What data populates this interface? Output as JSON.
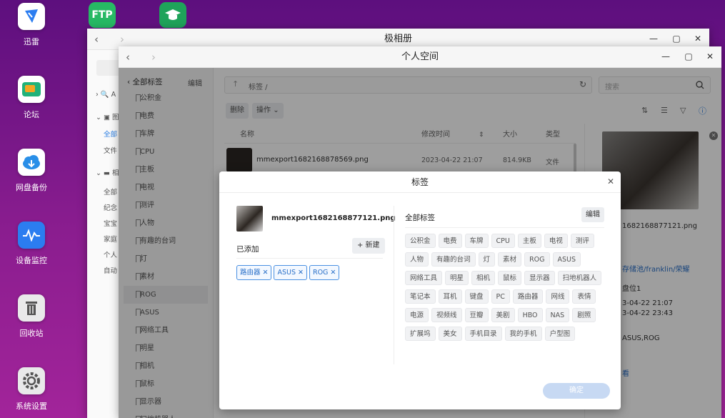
{
  "desktop": {
    "icons": [
      {
        "label": "迅雷",
        "icon": "xunlei-icon"
      },
      {
        "label": "论坛",
        "icon": "forum-icon"
      },
      {
        "label": "网盘备份",
        "icon": "cloud-backup-icon"
      },
      {
        "label": "设备监控",
        "icon": "monitor-icon"
      },
      {
        "label": "回收站",
        "icon": "trash-icon"
      },
      {
        "label": "系统设置",
        "icon": "settings-icon"
      }
    ],
    "top_icons": [
      {
        "label": "FTP"
      },
      {
        "label": "",
        "icon": "graduation-cap-icon"
      }
    ]
  },
  "back_window": {
    "title": "极相册",
    "sidebar": [
      {
        "text": "A"
      },
      {
        "text": "图"
      },
      {
        "text": "全部"
      },
      {
        "text": "文件"
      },
      {
        "text": "相"
      },
      {
        "text": "全部"
      },
      {
        "text": "纪念"
      },
      {
        "text": "宝宝"
      },
      {
        "text": "家庭"
      },
      {
        "text": "个人"
      },
      {
        "text": "自动"
      }
    ]
  },
  "front_window": {
    "title": "个人空间",
    "left_header": "全部标签",
    "left_edit": "编辑",
    "tags_list": [
      "公积金",
      "电费",
      "车牌",
      "CPU",
      "主板",
      "电视",
      "测评",
      "人物",
      "有趣的台词",
      "灯",
      "素材",
      "ROG",
      "ASUS",
      "网络工具",
      "明星",
      "相机",
      "鼠标",
      "显示器",
      "扫地机器人"
    ],
    "selected_tag": "ROG",
    "path": "标签 /",
    "search_placeholder": "搜索",
    "buttons": {
      "delete": "删除",
      "operate": "操作"
    },
    "columns": {
      "name": "名称",
      "modified": "修改时间",
      "size": "大小",
      "type": "类型"
    },
    "row": {
      "name": "mmexport1682168878569.png",
      "modified": "2023-04-22 21:07",
      "size": "814.9KB",
      "type": "文件"
    },
    "info_panel": {
      "filename": "1682168877121.png",
      "path": "存储池/franklin/荣耀",
      "location": "盘位1",
      "date1": "3-04-22 21:07",
      "date2": "3-04-22 23:43",
      "tags": "ASUS,ROG",
      "link": "看"
    }
  },
  "dialog": {
    "title": "标签",
    "filename": "mmexport1682168877121.png",
    "added_label": "已添加",
    "new_button": "+ 新建",
    "added_tags": [
      "路由器",
      "ASUS",
      "ROG"
    ],
    "all_tags_label": "全部标签",
    "edit_button": "编辑",
    "all_tags": [
      "公积金",
      "电费",
      "车牌",
      "CPU",
      "主板",
      "电视",
      "测评",
      "人物",
      "有趣的台词",
      "灯",
      "素材",
      "ROG",
      "ASUS",
      "网络工具",
      "明星",
      "相机",
      "鼠标",
      "显示器",
      "扫地机器人",
      "笔记本",
      "耳机",
      "键盘",
      "PC",
      "路由器",
      "网线",
      "表情",
      "电源",
      "视频线",
      "豆瓣",
      "美剧",
      "HBO",
      "NAS",
      "剧照",
      "扩展坞",
      "美女",
      "手机目录",
      "我的手机",
      "户型图"
    ],
    "confirm": "确定"
  },
  "colors": {
    "accent": "#4a90e2",
    "chip_bg": "#f1f2f4",
    "confirm_bg": "#c7d9f3",
    "ftp_green": "#27b964"
  }
}
